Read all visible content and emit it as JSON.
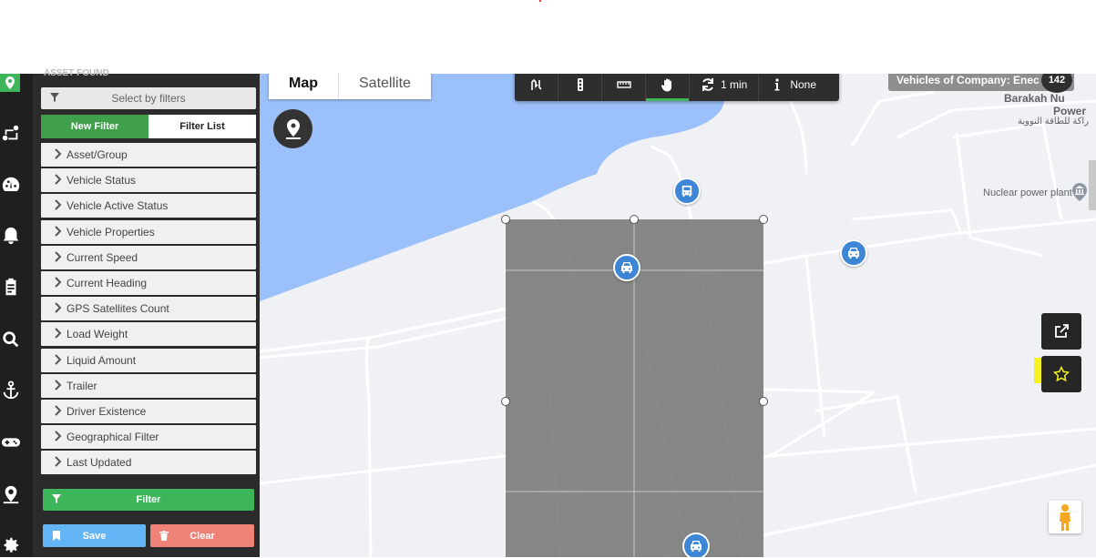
{
  "panel": {
    "header": "ASSET FOUND",
    "select_filters_label": "Select by filters",
    "tabs": {
      "new_filter": "New Filter",
      "filter_list": "Filter List"
    },
    "facets": [
      "Asset/Group",
      "Vehicle Status",
      "Vehicle Active Status",
      "Vehicle Properties",
      "Current Speed",
      "Current Heading",
      "GPS Satellites Count",
      "Load Weight",
      "Liquid Amount",
      "Trailer",
      "Driver Existence",
      "Geographical Filter",
      "Last Updated"
    ],
    "filter_button": "Filter",
    "save_button": "Save",
    "clear_button": "Clear"
  },
  "map": {
    "type_map": "Map",
    "type_satellite": "Satellite",
    "toolbar": {
      "refresh_label": "1 min",
      "info_label": "None"
    },
    "company_label": "Vehicles of Company: Enec",
    "vehicle_count": "142",
    "poi": {
      "barakah_line1": "Barakah Nu",
      "barakah_line2": "Power",
      "barakah_arabic": "راكة للطاقة النووية",
      "nuclear_plant": "Nuclear power plant"
    }
  },
  "colors": {
    "green": "#3db559",
    "dark": "#2b2b2b",
    "water": "#9cc0f9",
    "vehicle": "#3d86d6"
  }
}
